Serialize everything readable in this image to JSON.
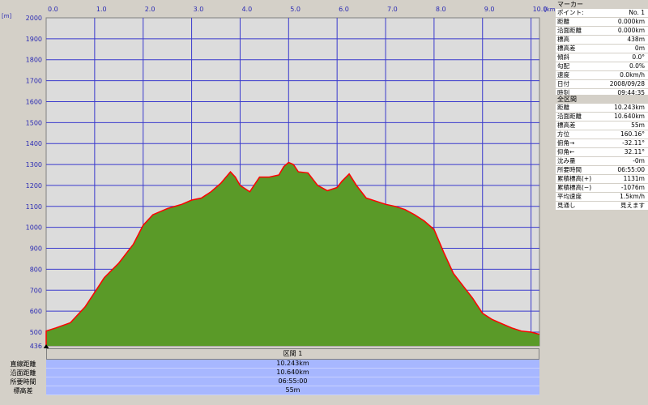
{
  "chart_data": {
    "type": "area",
    "x_unit": "[km]",
    "y_unit": "[m]",
    "xlim": [
      0,
      10.243
    ],
    "ylim": [
      436,
      2000
    ],
    "x_ticks": [
      "0.0",
      "1.0",
      "2.0",
      "3.0",
      "4.0",
      "5.0",
      "6.0",
      "7.0",
      "8.0",
      "9.0",
      "10.0"
    ],
    "y_ticks": [
      "436",
      "500",
      "600",
      "700",
      "800",
      "900",
      "1000",
      "1100",
      "1200",
      "1300",
      "1400",
      "1500",
      "1600",
      "1700",
      "1800",
      "1900",
      "2000"
    ],
    "grid": true,
    "colors": {
      "fill": "#5a9a28",
      "line": "#ff0000",
      "grid": "#3a3acd",
      "plot_bg": "#dcdcdc"
    },
    "x": [
      0,
      0.2,
      0.5,
      0.8,
      1.0,
      1.2,
      1.5,
      1.8,
      2.0,
      2.2,
      2.5,
      2.8,
      3.0,
      3.2,
      3.4,
      3.6,
      3.8,
      3.9,
      4.0,
      4.2,
      4.4,
      4.6,
      4.8,
      4.9,
      5.0,
      5.1,
      5.2,
      5.4,
      5.6,
      5.8,
      6.0,
      6.1,
      6.25,
      6.4,
      6.6,
      6.8,
      7.0,
      7.2,
      7.4,
      7.6,
      7.8,
      8.0,
      8.2,
      8.4,
      8.6,
      8.8,
      9.0,
      9.2,
      9.4,
      9.6,
      9.8,
      10.0,
      10.243
    ],
    "y": [
      505,
      520,
      545,
      620,
      690,
      760,
      830,
      920,
      1010,
      1060,
      1090,
      1110,
      1130,
      1140,
      1170,
      1210,
      1265,
      1240,
      1200,
      1170,
      1240,
      1240,
      1250,
      1290,
      1310,
      1300,
      1265,
      1260,
      1200,
      1175,
      1190,
      1220,
      1255,
      1200,
      1140,
      1125,
      1110,
      1100,
      1085,
      1060,
      1030,
      990,
      880,
      780,
      720,
      660,
      590,
      560,
      540,
      520,
      505,
      500,
      490
    ]
  },
  "section_header": "区間 1",
  "summary": [
    {
      "label": "直線距離",
      "value": "10.243km"
    },
    {
      "label": "沿面距離",
      "value": "10.640km"
    },
    {
      "label": "所要時間",
      "value": "06:55:00"
    },
    {
      "label": "標高差",
      "value": "55m"
    }
  ],
  "marker": {
    "title": "マーカー",
    "rows": [
      {
        "label": "ポイント:",
        "value": "No. 1"
      },
      {
        "label": "距離",
        "value": "0.000km"
      },
      {
        "label": "沿面距離",
        "value": "0.000km"
      },
      {
        "label": "標高",
        "value": "438m"
      },
      {
        "label": "標高差",
        "value": "0m"
      },
      {
        "label": "傾斜",
        "value": "0.0°"
      },
      {
        "label": "勾配",
        "value": "0.0%"
      },
      {
        "label": "速度",
        "value": "0.0km/h"
      },
      {
        "label": "日付",
        "value": "2008/09/28"
      },
      {
        "label": "時刻",
        "value": "09:44:35"
      }
    ]
  },
  "all_sections": {
    "title": "全区間",
    "rows": [
      {
        "label": "距離",
        "value": "10.243km"
      },
      {
        "label": "沿面距離",
        "value": "10.640km"
      },
      {
        "label": "標高差",
        "value": "55m"
      },
      {
        "label": "方位",
        "value": "160.16°"
      },
      {
        "label": "俯角→",
        "value": "-32.11°"
      },
      {
        "label": "仰角←",
        "value": "32.11°"
      },
      {
        "label": "沈み量",
        "value": "-0m"
      },
      {
        "label": "所要時間",
        "value": "06:55:00"
      },
      {
        "label": "累積標高(+)",
        "value": "1131m"
      },
      {
        "label": "累積標高(−)",
        "value": "-1076m"
      },
      {
        "label": "平均速度",
        "value": "1.5km/h"
      },
      {
        "label": "見通し",
        "value": "見えます"
      }
    ]
  }
}
